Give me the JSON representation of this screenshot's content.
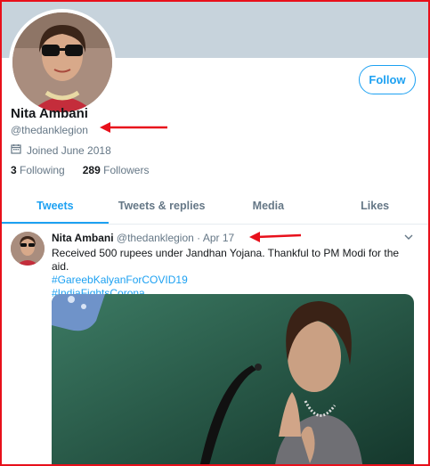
{
  "profile": {
    "name": "Nita Ambani",
    "handle": "@thedanklegion",
    "joined": "Joined June 2018",
    "following_count": "3",
    "following_label": "Following",
    "followers_count": "289",
    "followers_label": "Followers",
    "follow_button": "Follow"
  },
  "tabs": [
    {
      "label": "Tweets"
    },
    {
      "label": "Tweets & replies"
    },
    {
      "label": "Media"
    },
    {
      "label": "Likes"
    }
  ],
  "tweet": {
    "name": "Nita Ambani",
    "handle": "@thedanklegion",
    "separator": "·",
    "date": "Apr 17",
    "text": "Received 500 rupees under Jandhan Yojana. Thankful to PM Modi for the aid.",
    "hashtag1": "#GareebKalyanForCOVID19",
    "hashtag2": "#IndiaFightsCorona"
  },
  "colors": {
    "accent": "#1da1f2",
    "annotation": "#e8101b",
    "banner": "#c7d3dc"
  },
  "icons": {
    "calendar": "calendar-icon",
    "chevron": "chevron-down-icon"
  }
}
